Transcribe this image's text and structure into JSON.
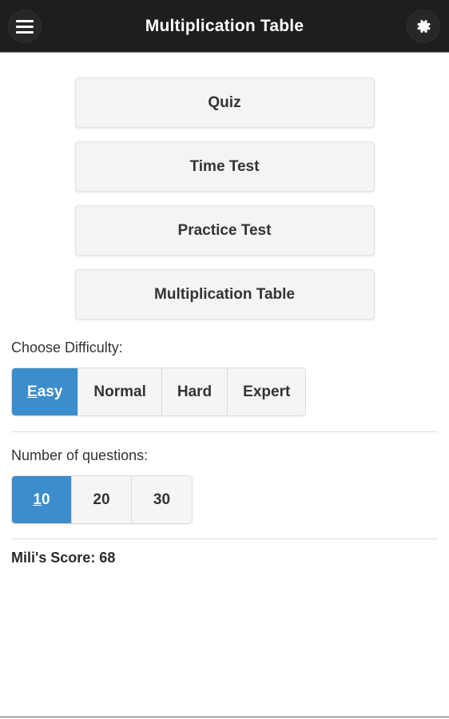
{
  "appbar": {
    "title": "Multiplication Table",
    "menu_icon": "hamburger-menu-icon",
    "settings_icon": "gear-icon",
    "background_color": "#1e1e1e",
    "title_color": "#ffffff"
  },
  "menu": {
    "buttons": [
      {
        "label": "Quiz"
      },
      {
        "label": "Time Test"
      },
      {
        "label": "Practice Test"
      },
      {
        "label": "Multiplication Table"
      }
    ]
  },
  "difficulty": {
    "label": "Choose Difficulty:",
    "selected": "Easy",
    "options": [
      {
        "label": "Easy",
        "accel": "E",
        "rest": "asy",
        "selected": true
      },
      {
        "label": "Normal",
        "accel": "",
        "rest": "Normal",
        "selected": false
      },
      {
        "label": "Hard",
        "accel": "",
        "rest": "Hard",
        "selected": false
      },
      {
        "label": "Expert",
        "accel": "",
        "rest": "Expert",
        "selected": false
      }
    ]
  },
  "questions": {
    "label": "Number of questions:",
    "selected": "10",
    "options": [
      {
        "label": "10",
        "accel": "1",
        "rest": "0",
        "selected": true
      },
      {
        "label": "20",
        "accel": "",
        "rest": "20",
        "selected": false
      },
      {
        "label": "30",
        "accel": "",
        "rest": "30",
        "selected": false
      }
    ]
  },
  "score": {
    "text": "Mili's Score: 68",
    "player": "Mili",
    "value": 68
  },
  "colors": {
    "accent": "#3b8dcc",
    "button_face": "#f4f4f4",
    "text": "#333333",
    "appbar": "#1e1e1e"
  }
}
